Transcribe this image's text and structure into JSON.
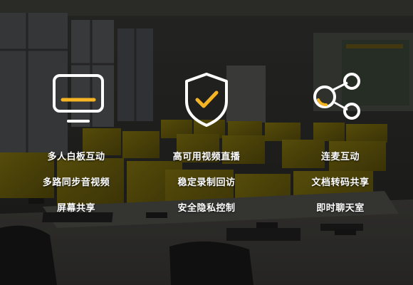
{
  "theme": {
    "accent": "#f5b423",
    "icon_stroke": "#ffffff",
    "text": "#ffffff"
  },
  "features": [
    {
      "icon": "monitor-icon",
      "items": [
        "多人白板互动",
        "多路同步音视频",
        "屏幕共享"
      ]
    },
    {
      "icon": "shield-check-icon",
      "items": [
        "高可用视频直播",
        "稳定录制回访",
        "安全隐私控制"
      ]
    },
    {
      "icon": "connection-nodes-icon",
      "items": [
        "连麦互动",
        "文档转码共享",
        "即时聊天室"
      ]
    }
  ]
}
